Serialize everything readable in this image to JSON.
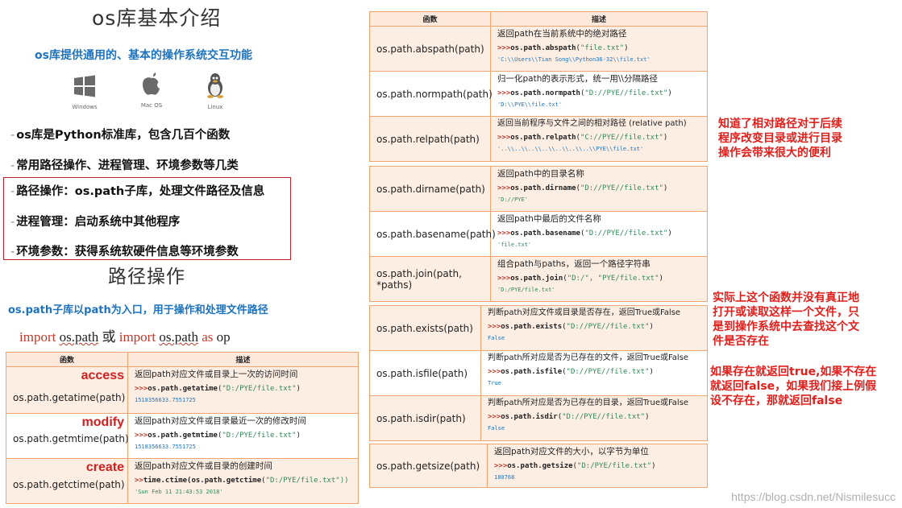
{
  "left": {
    "title": "os库基本介绍",
    "subtitle": "os库提供通用的、基本的操作系统交互功能",
    "os_icons": [
      {
        "name": "windows-icon",
        "label": "Windows"
      },
      {
        "name": "apple-icon",
        "label": "Mac OS"
      },
      {
        "name": "linux-icon",
        "label": "Linux"
      }
    ],
    "bullets": [
      "os库是Python标准库，包含几百个函数",
      "常用路径操作、进程管理、环境参数等几类",
      "路径操作：os.path子库，处理文件路径及信息",
      "进程管理：启动系统中其他程序",
      "环境参数：获得系统软硬件信息等环境参数"
    ],
    "bullet_dash": "-",
    "section_title": "路径操作",
    "section_subtitle": "os.path子库以path为入口，用于操作和处理文件路径",
    "import_line": {
      "kw1": "import",
      "mod1": "os.path",
      "or": "或",
      "kw2": "import",
      "mod2": "os.path",
      "kw3": "as",
      "alias": "op"
    }
  },
  "left_table": {
    "headers": [
      "函数",
      "描述"
    ],
    "rows": [
      {
        "tag": "access",
        "func": "os.path.getatime(path)",
        "desc": "返回path对应文件或目录上一次的访问时间",
        "prompt": ">>>",
        "call": "os.path.getatime",
        "arg": "\"D:/PYE/file.txt\"",
        "out": "1518356633.7551725"
      },
      {
        "tag": "modify",
        "func": "os.path.getmtime(path)",
        "desc": "返回path对应文件或目录最近一次的修改时间",
        "prompt": ">>>",
        "call": "os.path.getmtime",
        "arg": "\"D:/PYE/file.txt\"",
        "out": "1518356633.7551725"
      },
      {
        "tag": "create",
        "func": "os.path.getctime(path)",
        "desc": "返回path对应文件或目录的创建时间",
        "prompt": ">>",
        "call": "time.ctime(os.path.getctime",
        "arg": "\"D:/PYE/file.txt\"))",
        "out": "'Sun Feb 11 21:43:53 2018'"
      }
    ]
  },
  "right_table": {
    "headers": [
      "函数",
      "描述"
    ],
    "group1": [
      {
        "func": "os.path.abspath(path)",
        "desc": "返回path在当前系统中的绝对路径",
        "prompt": ">>>",
        "call": "os.path.abspath",
        "arg": "\"file.txt\"",
        "out": "'C:\\\\Users\\\\Tian Song\\\\Python36-32\\\\file.txt'"
      },
      {
        "func": "os.path.normpath(path)",
        "desc": "归一化path的表示形式，统一用\\\\分隔路径",
        "prompt": ">>>",
        "call": "os.path.normpath",
        "arg": "\"D://PYE//file.txt\"",
        "out": "'D:\\\\PYE\\\\file.txt'"
      },
      {
        "func": "os.path.relpath(path)",
        "desc": "返回当前程序与文件之间的相对路径 (relative path)",
        "prompt": ">>>",
        "call": "os.path.relpath",
        "arg": "\"C://PYE//file.txt\"",
        "out": "'..\\\\..\\\\..\\\\..\\\\..\\\\..\\\\..\\\\PYE\\\\file.txt'"
      }
    ],
    "group2": [
      {
        "func": "os.path.dirname(path)",
        "desc": "返回path中的目录名称",
        "prompt": ">>>",
        "call": "os.path.dirname",
        "arg": "\"D://PYE//file.txt\"",
        "out": "'D://PYE'"
      },
      {
        "func": "os.path.basename(path)",
        "desc": "返回path中最后的文件名称",
        "prompt": ">>>",
        "call": "os.path.basename",
        "arg": "\"D://PYE//file.txt\"",
        "out": "'file.txt'"
      },
      {
        "func": "os.path.join(path, *paths)",
        "desc": "组合path与paths，返回一个路径字符串",
        "prompt": ">>>",
        "call": "os.path.join",
        "arg": "\"D:/\", \"PYE/file.txt\"",
        "out": "'D:/PYE/file.txt'"
      }
    ],
    "group3": [
      {
        "func": "os.path.exists(path)",
        "desc": "判断path对应文件或目录是否存在，返回True或False",
        "prompt": ">>>",
        "call": "os.path.exists",
        "arg": "\"D://PYE//file.txt\"",
        "out": "False"
      },
      {
        "func": "os.path.isfile(path)",
        "desc": "判断path所对应是否为已存在的文件，返回True或False",
        "prompt": ">>>",
        "call": "os.path.isfile",
        "arg": "\"D://PYE//file.txt\"",
        "out": "True"
      },
      {
        "func": "os.path.isdir(path)",
        "desc": "判断path所对应是否为已存在的目录，返回True或False",
        "prompt": ">>>",
        "call": "os.path.isdir",
        "arg": "\"D://PYE//file.txt\"",
        "out": "False"
      }
    ],
    "group4": [
      {
        "func": "os.path.getsize(path)",
        "desc": "返回path对应文件的大小，以字节为单位",
        "prompt": ">>>",
        "call": "os.path.getsize",
        "arg": "\"D:/PYE/file.txt\"",
        "out": "180768"
      }
    ]
  },
  "notes": {
    "relpath_note": [
      "知道了相对路径对于后续",
      "程序改变目录或进行目录",
      "操作会带来很大的便利"
    ],
    "exists_note": [
      "实际上这个函数并没有真正地",
      "打开或读取这样一个文件，只",
      "是到操作系统中去查找这个文",
      "件是否存在"
    ],
    "exists_note2": [
      "如果存在就返回true,如果不存在",
      "就返回false，如果我们接上例假",
      "设不存在，那就返回false"
    ]
  },
  "watermark": "https://blog.csdn.net/Nismilesucc"
}
